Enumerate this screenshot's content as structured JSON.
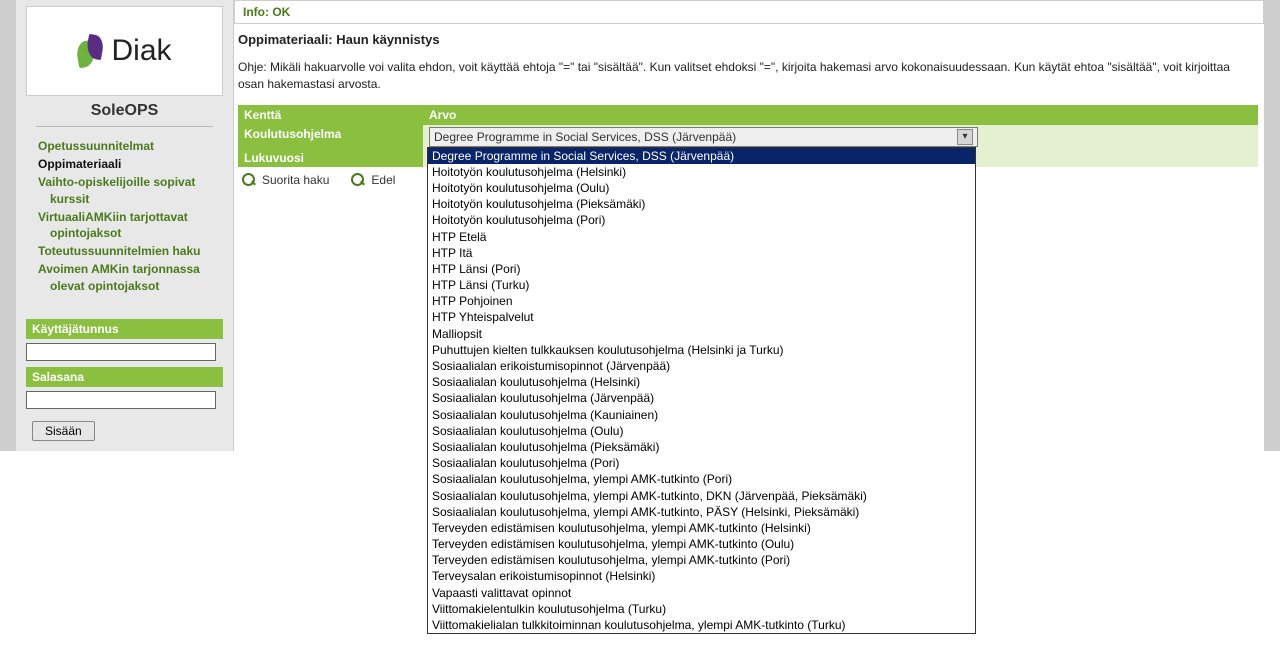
{
  "brand": {
    "logo_text": "Diak",
    "app_name": "SoleOPS"
  },
  "nav": {
    "items": [
      {
        "label": "Opetussuunnitelmat",
        "active": false
      },
      {
        "label": "Oppimateriaali",
        "active": true
      },
      {
        "label": "Vaihto-opiskelijoille sopivat kurssit",
        "active": false
      },
      {
        "label": "VirtuaaliAMKiin tarjottavat opintojaksot",
        "active": false
      },
      {
        "label": "Toteutussuunnitelmien haku",
        "active": false
      },
      {
        "label": "Avoimen AMKin tarjonnassa olevat opintojaksot",
        "active": false
      }
    ]
  },
  "login": {
    "user_label": "Käyttäjätunnus",
    "pass_label": "Salasana",
    "submit": "Sisään"
  },
  "info_bar": "Info: OK",
  "page_title": "Oppimateriaali: Haun käynnistys",
  "ohje": "Ohje: Mikäli hakuarvolle voi valita ehdon, voit käyttää ehtoja \"=\" tai \"sisältää\". Kun valitset ehdoksi \"=\", kirjoita hakemasi arvo kokonaisuudessaan. Kun käytät ehtoa \"sisältää\", voit kirjoittaa osan hakemastasi arvosta.",
  "table": {
    "head_field": "Kenttä",
    "head_value": "Arvo",
    "row1_label": "Koulutusohjelma",
    "row2_label": "Lukuvuosi"
  },
  "select": {
    "selected": "Degree Programme in Social Services, DSS (Järvenpää)",
    "options": [
      "Degree Programme in Social Services, DSS (Järvenpää)",
      "Hoitotyön koulutusohjelma (Helsinki)",
      "Hoitotyön koulutusohjelma (Oulu)",
      "Hoitotyön koulutusohjelma (Pieksämäki)",
      "Hoitotyön koulutusohjelma (Pori)",
      "HTP Etelä",
      "HTP Itä",
      "HTP Länsi (Pori)",
      "HTP Länsi (Turku)",
      "HTP Pohjoinen",
      "HTP Yhteispalvelut",
      "Malliopsit",
      "Puhuttujen kielten tulkkauksen koulutusohjelma (Helsinki ja Turku)",
      "Sosiaalialan erikoistumisopinnot (Järvenpää)",
      "Sosiaalialan koulutusohjelma (Helsinki)",
      "Sosiaalialan koulutusohjelma (Järvenpää)",
      "Sosiaalialan koulutusohjelma (Kauniainen)",
      "Sosiaalialan koulutusohjelma (Oulu)",
      "Sosiaalialan koulutusohjelma (Pieksämäki)",
      "Sosiaalialan koulutusohjelma (Pori)",
      "Sosiaalialan koulutusohjelma, ylempi AMK-tutkinto (Pori)",
      "Sosiaalialan koulutusohjelma, ylempi AMK-tutkinto, DKN (Järvenpää, Pieksämäki)",
      "Sosiaalialan koulutusohjelma, ylempi AMK-tutkinto, PÄSY (Helsinki, Pieksämäki)",
      "Terveyden edistämisen koulutusohjelma, ylempi AMK-tutkinto (Helsinki)",
      "Terveyden edistämisen koulutusohjelma, ylempi AMK-tutkinto (Oulu)",
      "Terveyden edistämisen koulutusohjelma, ylempi AMK-tutkinto (Pori)",
      "Terveysalan erikoistumisopinnot (Helsinki)",
      "Vapaasti valittavat opinnot",
      "Viittomakielentulkin koulutusohjelma (Turku)",
      "Viittomakielialan tulkkitoiminnan koulutusohjelma, ylempi AMK-tutkinto (Turku)"
    ]
  },
  "actions": {
    "run": "Suorita haku",
    "prev": "Edel"
  }
}
